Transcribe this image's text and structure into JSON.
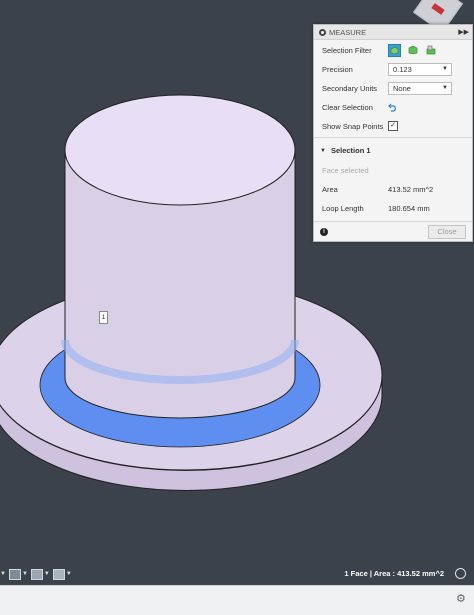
{
  "measure_panel": {
    "title": "MEASURE",
    "selection_filter_label": "Selection Filter",
    "precision_label": "Precision",
    "precision_value": "0.123",
    "secondary_units_label": "Secondary Units",
    "secondary_units_value": "None",
    "clear_selection_label": "Clear Selection",
    "show_snap_points_label": "Show Snap Points",
    "show_snap_points_checked": true,
    "selection_section_title": "Selection 1",
    "face_selected_text": "Face selected",
    "area_label": "Area",
    "area_value": "413.52 mm^2",
    "loop_length_label": "Loop Length",
    "loop_length_value": "180.654 mm",
    "close_label": "Close"
  },
  "viewport": {
    "selection_marker": "1"
  },
  "status_bar": {
    "summary": "1 Face | Area : 413.52 mm^2"
  },
  "colors": {
    "background": "#3b424b",
    "model_face": "#dcd2ea",
    "selected_face": "#5e8ff0",
    "accent": "#3aa0d8"
  },
  "icons": [
    "view-cube",
    "measure-icon",
    "expand-panel-icon",
    "select-bodies-icon",
    "select-faces-icon",
    "select-component-icon",
    "clear-selection-icon",
    "checkbox-icon",
    "collapse-triangle-icon",
    "info-icon",
    "display-settings-icon",
    "grid-icon",
    "viewports-icon",
    "snapshot-icon",
    "settings-icon"
  ]
}
